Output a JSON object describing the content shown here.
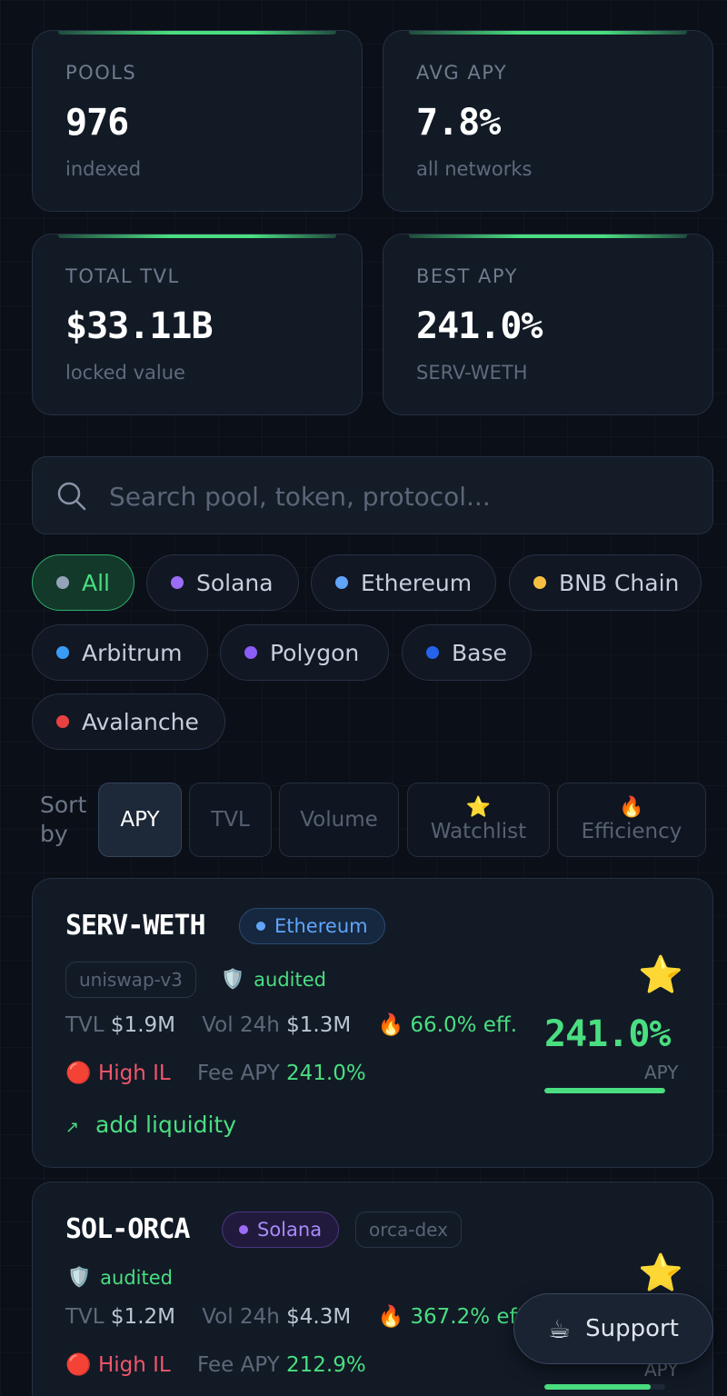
{
  "stats": [
    {
      "label": "POOLS",
      "value": "976",
      "sub": "indexed"
    },
    {
      "label": "AVG APY",
      "value": "7.8%",
      "sub": "all networks"
    },
    {
      "label": "TOTAL TVL",
      "value": "$33.11B",
      "sub": "locked value"
    },
    {
      "label": "BEST APY",
      "value": "241.0%",
      "sub": "SERV-WETH"
    }
  ],
  "search": {
    "placeholder": "Search pool, token, protocol..."
  },
  "chains": [
    {
      "label": "All",
      "color": "#94a3b8",
      "active": true
    },
    {
      "label": "Solana",
      "color": "#9b6cf5"
    },
    {
      "label": "Ethereum",
      "color": "#60a5fa"
    },
    {
      "label": "BNB Chain",
      "color": "#f5c042"
    },
    {
      "label": "Arbitrum",
      "color": "#3b9cf5"
    },
    {
      "label": "Polygon",
      "color": "#8b5cf6"
    },
    {
      "label": "Base",
      "color": "#2563eb"
    },
    {
      "label": "Avalanche",
      "color": "#e84142"
    }
  ],
  "sort": {
    "label_line1": "Sort",
    "label_line2": "by",
    "options": [
      {
        "label": "APY",
        "active": true
      },
      {
        "label": "TVL"
      },
      {
        "label": "Volume"
      },
      {
        "label": "Watchlist",
        "emoji": "⭐"
      },
      {
        "label": "Efficiency",
        "emoji": "🔥"
      }
    ]
  },
  "pools": [
    {
      "name": "SERV-WETH",
      "network": "Ethereum",
      "protocol": "uniswap-v3",
      "audited": "audited",
      "tvl_label": "TVL",
      "tvl": "$1.9M",
      "vol_label": "Vol 24h",
      "vol": "$1.3M",
      "eff": "66.0% eff.",
      "il": "High IL",
      "fee_label": "Fee APY",
      "fee": "241.0%",
      "apy": "241.0%",
      "apy_caption": "APY",
      "apy_bar_fraction": 1.0,
      "action": "add liquidity"
    },
    {
      "name": "SOL-ORCA",
      "network": "Solana",
      "protocol": "orca-dex",
      "audited": "audited",
      "tvl_label": "TVL",
      "tvl": "$1.2M",
      "vol_label": "Vol 24h",
      "vol": "$4.3M",
      "eff": "367.2% eff.",
      "il": "High IL",
      "fee_label": "Fee APY",
      "fee": "212.9%",
      "apy_caption": "APY",
      "apy_bar_fraction": 0.88
    }
  ],
  "support": {
    "label": "Support",
    "emoji": "☕"
  },
  "icons": {
    "star": "⭐",
    "fire": "🔥",
    "shield": "🛡️",
    "il": "🔴",
    "arrow": "↗"
  }
}
